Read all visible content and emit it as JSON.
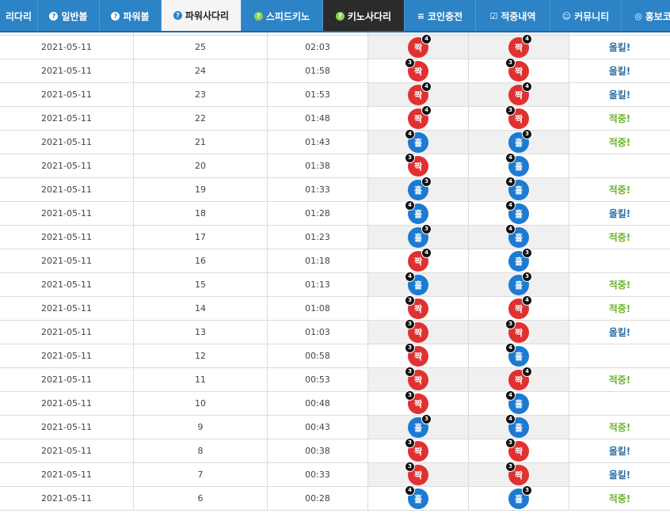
{
  "nav": [
    {
      "label": "리다리",
      "icon": "",
      "style": "normal",
      "width": 48
    },
    {
      "label": "일반볼",
      "icon": "info-icon",
      "style": "normal",
      "width": 78
    },
    {
      "label": "파워볼",
      "icon": "info-icon",
      "style": "normal",
      "width": 78
    },
    {
      "label": "파워사다리",
      "icon": "info-icon",
      "style": "active",
      "width": 101
    },
    {
      "label": "스피드키노",
      "icon": "help-icon",
      "style": "normal",
      "width": 103
    },
    {
      "label": "키노사다리",
      "icon": "help-icon",
      "style": "dark",
      "width": 103
    },
    {
      "label": "코인충전",
      "icon": "coin-icon",
      "style": "normal",
      "width": 90
    },
    {
      "label": "적중내역",
      "icon": "check-icon",
      "style": "normal",
      "width": 94
    },
    {
      "label": "커뮤니티",
      "icon": "smile-icon",
      "style": "normal",
      "width": 90
    },
    {
      "label": "홍보코",
      "icon": "globe-icon",
      "style": "normal",
      "width": 80
    }
  ],
  "colors": {
    "nav_bg": "#2c83c5",
    "odd_red": "#e03131",
    "even_blue": "#1c7ad2",
    "hit": "#6ab42a",
    "miss": "#2d6fa3"
  },
  "rows": [
    {
      "date": "2021-05-11",
      "round": "25",
      "time": "02:03",
      "p1": {
        "text": "짝",
        "color": "red",
        "badge": "4",
        "pos": "tr"
      },
      "p2": {
        "text": "짝",
        "color": "red",
        "badge": "4",
        "pos": "tr"
      },
      "result": "올킬!",
      "result_type": "miss"
    },
    {
      "date": "2021-05-11",
      "round": "24",
      "time": "01:58",
      "p1": {
        "text": "짝",
        "color": "red",
        "badge": "3",
        "pos": "tl"
      },
      "p2": {
        "text": "짝",
        "color": "red",
        "badge": "3",
        "pos": "tl"
      },
      "result": "올킬!",
      "result_type": "miss"
    },
    {
      "date": "2021-05-11",
      "round": "23",
      "time": "01:53",
      "p1": {
        "text": "짝",
        "color": "red",
        "badge": "4",
        "pos": "tr"
      },
      "p2": {
        "text": "짝",
        "color": "red",
        "badge": "4",
        "pos": "tr"
      },
      "result": "올킬!",
      "result_type": "miss"
    },
    {
      "date": "2021-05-11",
      "round": "22",
      "time": "01:48",
      "p1": {
        "text": "짝",
        "color": "red",
        "badge": "4",
        "pos": "tr"
      },
      "p2": {
        "text": "짝",
        "color": "red",
        "badge": "3",
        "pos": "tl"
      },
      "result": "적중!",
      "result_type": "hit"
    },
    {
      "date": "2021-05-11",
      "round": "21",
      "time": "01:43",
      "p1": {
        "text": "홀",
        "color": "blue",
        "badge": "4",
        "pos": "tl"
      },
      "p2": {
        "text": "홀",
        "color": "blue",
        "badge": "3",
        "pos": "tr"
      },
      "result": "적중!",
      "result_type": "hit"
    },
    {
      "date": "2021-05-11",
      "round": "20",
      "time": "01:38",
      "p1": {
        "text": "짝",
        "color": "red",
        "badge": "3",
        "pos": "tl"
      },
      "p2": {
        "text": "홀",
        "color": "blue",
        "badge": "4",
        "pos": "tl"
      },
      "result": "",
      "result_type": "none"
    },
    {
      "date": "2021-05-11",
      "round": "19",
      "time": "01:33",
      "p1": {
        "text": "홀",
        "color": "blue",
        "badge": "3",
        "pos": "tr"
      },
      "p2": {
        "text": "홀",
        "color": "blue",
        "badge": "4",
        "pos": "tl"
      },
      "result": "적중!",
      "result_type": "hit"
    },
    {
      "date": "2021-05-11",
      "round": "18",
      "time": "01:28",
      "p1": {
        "text": "홀",
        "color": "blue",
        "badge": "4",
        "pos": "tl"
      },
      "p2": {
        "text": "홀",
        "color": "blue",
        "badge": "4",
        "pos": "tl"
      },
      "result": "올킬!",
      "result_type": "miss"
    },
    {
      "date": "2021-05-11",
      "round": "17",
      "time": "01:23",
      "p1": {
        "text": "홀",
        "color": "blue",
        "badge": "3",
        "pos": "tr"
      },
      "p2": {
        "text": "홀",
        "color": "blue",
        "badge": "4",
        "pos": "tl"
      },
      "result": "적중!",
      "result_type": "hit"
    },
    {
      "date": "2021-05-11",
      "round": "16",
      "time": "01:18",
      "p1": {
        "text": "짝",
        "color": "red",
        "badge": "4",
        "pos": "tr"
      },
      "p2": {
        "text": "홀",
        "color": "blue",
        "badge": "3",
        "pos": "tr"
      },
      "result": "",
      "result_type": "none"
    },
    {
      "date": "2021-05-11",
      "round": "15",
      "time": "01:13",
      "p1": {
        "text": "홀",
        "color": "blue",
        "badge": "4",
        "pos": "tl"
      },
      "p2": {
        "text": "홀",
        "color": "blue",
        "badge": "3",
        "pos": "tr"
      },
      "result": "적중!",
      "result_type": "hit"
    },
    {
      "date": "2021-05-11",
      "round": "14",
      "time": "01:08",
      "p1": {
        "text": "짝",
        "color": "red",
        "badge": "3",
        "pos": "tl"
      },
      "p2": {
        "text": "짝",
        "color": "red",
        "badge": "4",
        "pos": "tr"
      },
      "result": "적중!",
      "result_type": "hit"
    },
    {
      "date": "2021-05-11",
      "round": "13",
      "time": "01:03",
      "p1": {
        "text": "짝",
        "color": "red",
        "badge": "3",
        "pos": "tl"
      },
      "p2": {
        "text": "짝",
        "color": "red",
        "badge": "3",
        "pos": "tl"
      },
      "result": "올킬!",
      "result_type": "miss"
    },
    {
      "date": "2021-05-11",
      "round": "12",
      "time": "00:58",
      "p1": {
        "text": "짝",
        "color": "red",
        "badge": "3",
        "pos": "tl"
      },
      "p2": {
        "text": "홀",
        "color": "blue",
        "badge": "4",
        "pos": "tl"
      },
      "result": "",
      "result_type": "none"
    },
    {
      "date": "2021-05-11",
      "round": "11",
      "time": "00:53",
      "p1": {
        "text": "짝",
        "color": "red",
        "badge": "3",
        "pos": "tl"
      },
      "p2": {
        "text": "짝",
        "color": "red",
        "badge": "4",
        "pos": "tr"
      },
      "result": "적중!",
      "result_type": "hit"
    },
    {
      "date": "2021-05-11",
      "round": "10",
      "time": "00:48",
      "p1": {
        "text": "짝",
        "color": "red",
        "badge": "3",
        "pos": "tl"
      },
      "p2": {
        "text": "홀",
        "color": "blue",
        "badge": "4",
        "pos": "tl"
      },
      "result": "",
      "result_type": "none"
    },
    {
      "date": "2021-05-11",
      "round": "9",
      "time": "00:43",
      "p1": {
        "text": "홀",
        "color": "blue",
        "badge": "3",
        "pos": "tr"
      },
      "p2": {
        "text": "홀",
        "color": "blue",
        "badge": "4",
        "pos": "tl"
      },
      "result": "적중!",
      "result_type": "hit"
    },
    {
      "date": "2021-05-11",
      "round": "8",
      "time": "00:38",
      "p1": {
        "text": "짝",
        "color": "red",
        "badge": "3",
        "pos": "tl"
      },
      "p2": {
        "text": "짝",
        "color": "red",
        "badge": "3",
        "pos": "tl"
      },
      "result": "올킬!",
      "result_type": "miss"
    },
    {
      "date": "2021-05-11",
      "round": "7",
      "time": "00:33",
      "p1": {
        "text": "짝",
        "color": "red",
        "badge": "3",
        "pos": "tl"
      },
      "p2": {
        "text": "짝",
        "color": "red",
        "badge": "3",
        "pos": "tl"
      },
      "result": "올킬!",
      "result_type": "miss"
    },
    {
      "date": "2021-05-11",
      "round": "6",
      "time": "00:28",
      "p1": {
        "text": "홀",
        "color": "blue",
        "badge": "4",
        "pos": "tl"
      },
      "p2": {
        "text": "홀",
        "color": "blue",
        "badge": "3",
        "pos": "tr"
      },
      "result": "적중!",
      "result_type": "hit"
    }
  ]
}
